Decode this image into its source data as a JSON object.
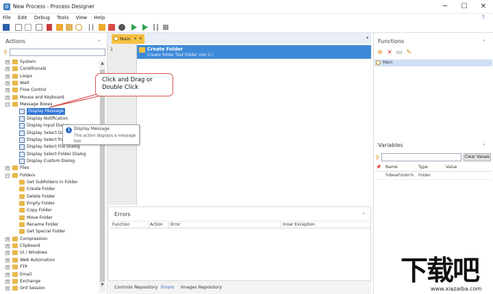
{
  "window": {
    "title": "New Process - Process Designer",
    "minimize": "─",
    "maximize": "☐",
    "close": "✕"
  },
  "menu": {
    "items": [
      "File",
      "Edit",
      "Debug",
      "Tools",
      "View",
      "Help"
    ],
    "help_icon": "?"
  },
  "actions": {
    "title": "Actions",
    "pin": "ᵖ",
    "search_placeholder": "",
    "tree": [
      {
        "label": "System",
        "type": "category",
        "expander": "+"
      },
      {
        "label": "Conditionals",
        "type": "category",
        "expander": "+"
      },
      {
        "label": "Loops",
        "type": "category",
        "expander": "+"
      },
      {
        "label": "Wait",
        "type": "category",
        "expander": "+"
      },
      {
        "label": "Flow Control",
        "type": "category",
        "expander": "+"
      },
      {
        "label": "Mouse and Keyboard",
        "type": "category",
        "expander": "+"
      },
      {
        "label": "Message Boxes",
        "type": "category",
        "expander": "−"
      },
      {
        "label": "Display Message",
        "type": "action",
        "selected": true
      },
      {
        "label": "Display Notification",
        "type": "action"
      },
      {
        "label": "Display Input Dialog",
        "type": "action"
      },
      {
        "label": "Display Select Date",
        "type": "action"
      },
      {
        "label": "Display Select from",
        "type": "action"
      },
      {
        "label": "Display Select File Dialog",
        "type": "action"
      },
      {
        "label": "Display Select Folder Dialog",
        "type": "action"
      },
      {
        "label": "Display Custom Dialog",
        "type": "action"
      },
      {
        "label": "Files",
        "type": "category",
        "expander": "+"
      },
      {
        "label": "Folders",
        "type": "category",
        "expander": "−"
      },
      {
        "label": "Get Subfolders in Folder",
        "type": "folder-action"
      },
      {
        "label": "Create Folder",
        "type": "folder-action"
      },
      {
        "label": "Delete Folder",
        "type": "folder-action"
      },
      {
        "label": "Empty Folder",
        "type": "folder-action"
      },
      {
        "label": "Copy Folder",
        "type": "folder-action"
      },
      {
        "label": "Move Folder",
        "type": "folder-action"
      },
      {
        "label": "Rename Folder",
        "type": "folder-action"
      },
      {
        "label": "Get Special Folder",
        "type": "folder-action"
      },
      {
        "label": "Compression",
        "type": "category",
        "expander": "+"
      },
      {
        "label": "Clipboard",
        "type": "category",
        "expander": "+"
      },
      {
        "label": "UI / Windows",
        "type": "category",
        "expander": "+"
      },
      {
        "label": "Web Automation",
        "type": "category",
        "expander": "+"
      },
      {
        "label": "FTP",
        "type": "category",
        "expander": "+"
      },
      {
        "label": "Email",
        "type": "category",
        "expander": "+"
      },
      {
        "label": "Exchange",
        "type": "category",
        "expander": "+"
      },
      {
        "label": "Ord Session",
        "type": "category",
        "expander": "+"
      }
    ]
  },
  "callout": {
    "line1": "Click and Drag or",
    "line2": "Double Click"
  },
  "tooltip": {
    "title": "Display Message",
    "description": "This action displays a message box"
  },
  "editor": {
    "tab_label": "Main",
    "tab_dropdown": "▾",
    "tab_close": "×",
    "line_number": "1",
    "step": {
      "title": "Create Folder",
      "description": "Create folder Test Folder into C:\\"
    }
  },
  "errors": {
    "title": "Errors",
    "columns": [
      "Function",
      "Action",
      "Error",
      "Inner Exception"
    ]
  },
  "bottom_tabs": [
    "Controls Repository",
    "Errors",
    "Images Repository"
  ],
  "functions": {
    "title": "Functions",
    "items": [
      "Main"
    ]
  },
  "variables": {
    "title": "Variables",
    "clear_label": "Clear Values",
    "columns": [
      "Name",
      "Type",
      "Value"
    ],
    "rows": [
      {
        "name": "%NewFolder%",
        "type": "Folder",
        "value": ""
      }
    ]
  },
  "watermark": {
    "main": "下载吧",
    "sub": "www.xiazaiba.com"
  },
  "colors": {
    "selection": "#3377d4",
    "step": "#3e8ad8",
    "tab": "#f5c242",
    "callout_border": "#d9534f"
  }
}
